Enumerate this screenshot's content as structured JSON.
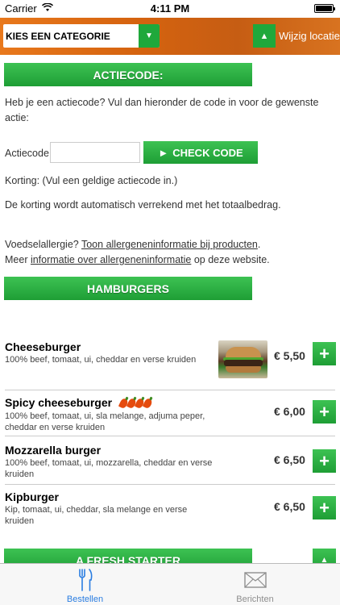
{
  "status_bar": {
    "carrier": "Carrier",
    "time": "4:11 PM"
  },
  "topbar": {
    "category_label": "KIES EEN CATEGORIE",
    "location_label": "Wijzig locatie"
  },
  "promo": {
    "header": "ACTIECODE:",
    "intro": "Heb je een actiecode? Vul dan hieronder de code in voor de gewenste actie:",
    "code_label": "Actiecode",
    "code_value": "",
    "check_button": "CHECK CODE",
    "discount_text": "Korting: (Vul een geldige actiecode in.)",
    "auto_text": "De korting wordt automatisch verrekend met het totaalbedrag.",
    "allergy_prefix": "Voedselallergie? ",
    "allergy_link": "Toon allergeneninformatie bij producten",
    "allergy_suffix": ".",
    "more_prefix": "Meer ",
    "more_link": "informatie over allergeneninformatie",
    "more_suffix": " op deze website."
  },
  "sections": [
    {
      "title": "HAMBURGERS",
      "items": [
        {
          "name": "Cheeseburger",
          "desc": "100% beef, tomaat, ui, cheddar en verse kruiden",
          "price": "€ 5,50",
          "has_image": true,
          "spice_level": 0
        },
        {
          "name": "Spicy cheeseburger",
          "desc": "100% beef, tomaat, ui, sla melange, adjuma peper, cheddar en verse kruiden",
          "price": "€ 6,00",
          "has_image": false,
          "spice_level": 4
        },
        {
          "name": "Mozzarella burger",
          "desc": "100% beef, tomaat, ui, mozzarella, cheddar en verse kruiden",
          "price": "€ 6,50",
          "has_image": false,
          "spice_level": 0
        },
        {
          "name": "Kipburger",
          "desc": "Kip, tomaat, ui, cheddar, sla melange en verse kruiden",
          "price": "€ 6,50",
          "has_image": false,
          "spice_level": 0
        }
      ]
    },
    {
      "title": "A FRESH STARTER"
    }
  ],
  "tabbar": {
    "tabs": [
      {
        "label": "Bestellen",
        "icon": "fork-knife-icon",
        "active": true
      },
      {
        "label": "Berichten",
        "icon": "envelope-icon",
        "active": false
      }
    ]
  },
  "colors": {
    "accent_green": "#1fa83b",
    "header_orange": "#d5630f",
    "tab_active": "#2a7de1"
  }
}
